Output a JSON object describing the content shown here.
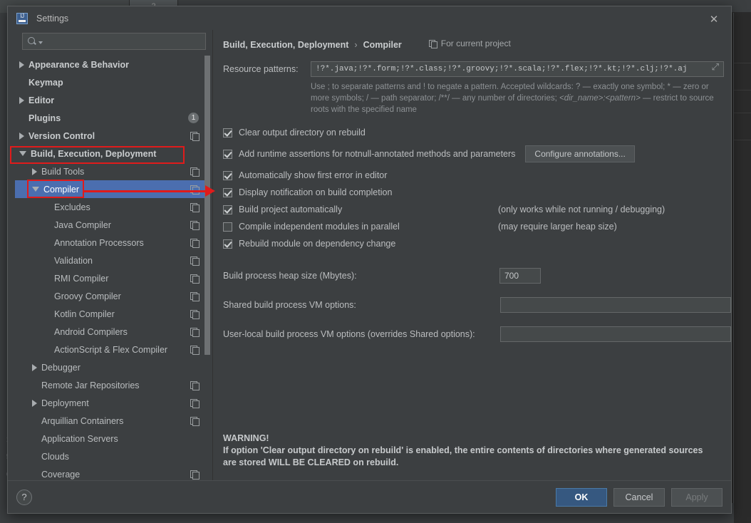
{
  "background": {
    "tab1_label": "",
    "tab2_label": "2",
    "left_gutter": [
      "1",
      "5",
      "e"
    ]
  },
  "dialog": {
    "title": "Settings",
    "close_icon": "close-icon",
    "app_icon": "intellij-idea-icon"
  },
  "search": {
    "value": "",
    "placeholder": "",
    "icon": "search-icon"
  },
  "sidebar": {
    "items": [
      {
        "label": "Appearance & Behavior",
        "indent": 0,
        "arrow": "right",
        "bold": true,
        "badge": null,
        "copy": false,
        "selected": false
      },
      {
        "label": "Keymap",
        "indent": 0,
        "arrow": "none",
        "bold": true,
        "badge": null,
        "copy": false,
        "selected": false
      },
      {
        "label": "Editor",
        "indent": 0,
        "arrow": "right",
        "bold": true,
        "badge": null,
        "copy": false,
        "selected": false
      },
      {
        "label": "Plugins",
        "indent": 0,
        "arrow": "none",
        "bold": true,
        "badge": "1",
        "copy": false,
        "selected": false
      },
      {
        "label": "Version Control",
        "indent": 0,
        "arrow": "right",
        "bold": true,
        "badge": null,
        "copy": true,
        "selected": false
      },
      {
        "label": "Build, Execution, Deployment",
        "indent": 0,
        "arrow": "down",
        "bold": true,
        "badge": null,
        "copy": false,
        "selected": false
      },
      {
        "label": "Build Tools",
        "indent": 1,
        "arrow": "right",
        "bold": false,
        "badge": null,
        "copy": true,
        "selected": false
      },
      {
        "label": "Compiler",
        "indent": 1,
        "arrow": "down",
        "bold": false,
        "badge": null,
        "copy": true,
        "selected": true
      },
      {
        "label": "Excludes",
        "indent": 2,
        "arrow": "none",
        "bold": false,
        "badge": null,
        "copy": true,
        "selected": false
      },
      {
        "label": "Java Compiler",
        "indent": 2,
        "arrow": "none",
        "bold": false,
        "badge": null,
        "copy": true,
        "selected": false
      },
      {
        "label": "Annotation Processors",
        "indent": 2,
        "arrow": "none",
        "bold": false,
        "badge": null,
        "copy": true,
        "selected": false
      },
      {
        "label": "Validation",
        "indent": 2,
        "arrow": "none",
        "bold": false,
        "badge": null,
        "copy": true,
        "selected": false
      },
      {
        "label": "RMI Compiler",
        "indent": 2,
        "arrow": "none",
        "bold": false,
        "badge": null,
        "copy": true,
        "selected": false
      },
      {
        "label": "Groovy Compiler",
        "indent": 2,
        "arrow": "none",
        "bold": false,
        "badge": null,
        "copy": true,
        "selected": false
      },
      {
        "label": "Kotlin Compiler",
        "indent": 2,
        "arrow": "none",
        "bold": false,
        "badge": null,
        "copy": true,
        "selected": false
      },
      {
        "label": "Android Compilers",
        "indent": 2,
        "arrow": "none",
        "bold": false,
        "badge": null,
        "copy": true,
        "selected": false
      },
      {
        "label": "ActionScript & Flex Compiler",
        "indent": 2,
        "arrow": "none",
        "bold": false,
        "badge": null,
        "copy": true,
        "selected": false
      },
      {
        "label": "Debugger",
        "indent": 1,
        "arrow": "right",
        "bold": false,
        "badge": null,
        "copy": false,
        "selected": false
      },
      {
        "label": "Remote Jar Repositories",
        "indent": 1,
        "arrow": "none",
        "bold": false,
        "badge": null,
        "copy": true,
        "selected": false
      },
      {
        "label": "Deployment",
        "indent": 1,
        "arrow": "right",
        "bold": false,
        "badge": null,
        "copy": true,
        "selected": false
      },
      {
        "label": "Arquillian Containers",
        "indent": 1,
        "arrow": "none",
        "bold": false,
        "badge": null,
        "copy": true,
        "selected": false
      },
      {
        "label": "Application Servers",
        "indent": 1,
        "arrow": "none",
        "bold": false,
        "badge": null,
        "copy": false,
        "selected": false
      },
      {
        "label": "Clouds",
        "indent": 1,
        "arrow": "none",
        "bold": false,
        "badge": null,
        "copy": false,
        "selected": false
      },
      {
        "label": "Coverage",
        "indent": 1,
        "arrow": "none",
        "bold": false,
        "badge": null,
        "copy": true,
        "selected": false
      }
    ]
  },
  "content": {
    "breadcrumb_parent": "Build, Execution, Deployment",
    "breadcrumb_sep": "›",
    "breadcrumb_current": "Compiler",
    "scope_label": "For current project",
    "scope_icon": "project-scope-icon",
    "resource_patterns_label": "Resource patterns:",
    "resource_patterns_value": "!?*.java;!?*.form;!?*.class;!?*.groovy;!?*.scala;!?*.flex;!?*.kt;!?*.clj;!?*.aj",
    "resource_patterns_expand_icon": "expand-editor-icon",
    "resource_patterns_hint_1": "Use ; to separate patterns and ! to negate a pattern. Accepted wildcards: ? — exactly one symbol; * — zero or",
    "resource_patterns_hint_2a": "more symbols; / — path separator; /**/ — any number of directories; ",
    "resource_patterns_hint_2b": "<dir_name>:<pattern>",
    "resource_patterns_hint_2c": " — restrict to",
    "resource_patterns_hint_3": "source roots with the specified name",
    "checkboxes": [
      {
        "label": "Clear output directory on rebuild",
        "checked": true,
        "note": null
      },
      {
        "label": "Add runtime assertions for notnull-annotated methods and parameters",
        "checked": true,
        "note": null
      },
      {
        "label": "Automatically show first error in editor",
        "checked": true,
        "note": null
      },
      {
        "label": "Display notification on build completion",
        "checked": true,
        "note": null
      },
      {
        "label": "Build project automatically",
        "checked": true,
        "note": "(only works while not running / debugging)"
      },
      {
        "label": "Compile independent modules in parallel",
        "checked": false,
        "note": "(may require larger heap size)"
      },
      {
        "label": "Rebuild module on dependency change",
        "checked": true,
        "note": null
      }
    ],
    "configure_annotations_button": "Configure annotations...",
    "heap_label": "Build process heap size (Mbytes):",
    "heap_value": "700",
    "shared_vm_label": "Shared build process VM options:",
    "shared_vm_value": "",
    "user_vm_label": "User-local build process VM options (overrides Shared options):",
    "user_vm_value": "",
    "warning_title": "WARNING!",
    "warning_line1": "If option 'Clear output directory on rebuild' is enabled, the entire contents of directories where generated sources",
    "warning_line2": "are stored WILL BE CLEARED on rebuild."
  },
  "footer": {
    "help_label": "?",
    "ok_label": "OK",
    "cancel_label": "Cancel",
    "apply_label": "Apply"
  },
  "annotations": {
    "accent_color": "#e01b1b",
    "highlight_build_execution_deployment": true,
    "highlight_compiler": true,
    "arrow_to": "build-project-automatically-checkbox"
  }
}
